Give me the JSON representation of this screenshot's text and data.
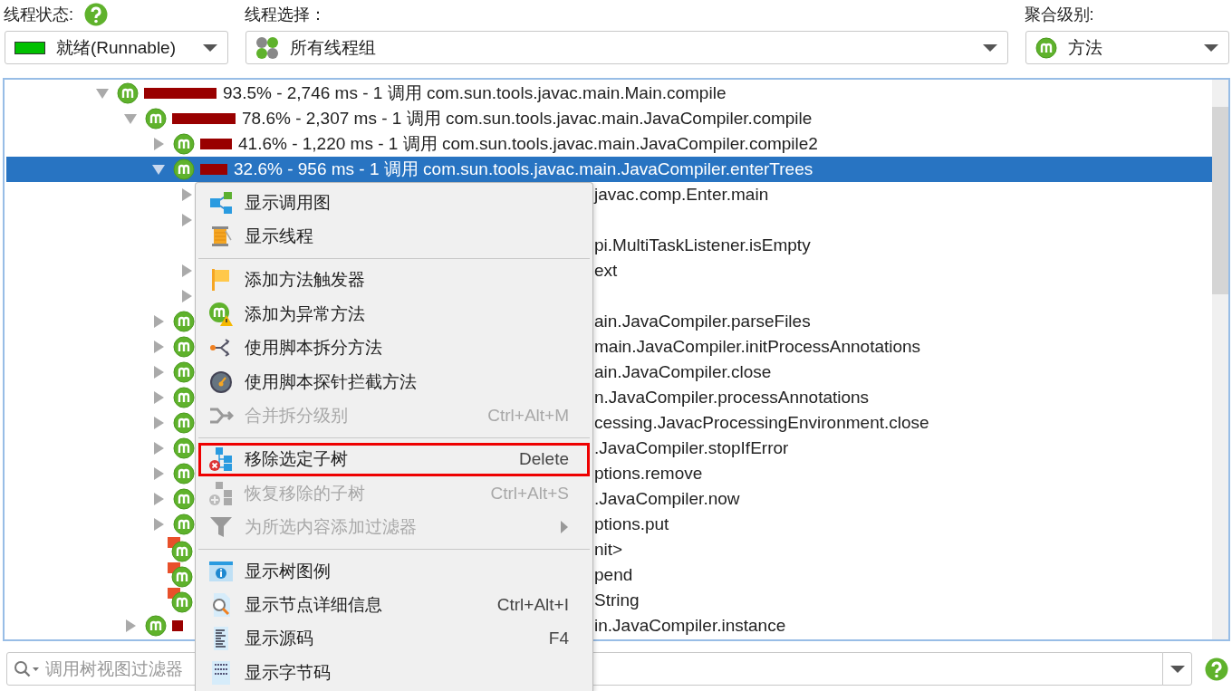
{
  "toolbar": {
    "thread_state": {
      "label": "线程状态:",
      "value": "就绪(Runnable)",
      "color": "#00c000"
    },
    "thread_selection": {
      "label": "线程选择：",
      "value": "所有线程组"
    },
    "aggregation": {
      "label": "聚合级别:",
      "value": "方法"
    }
  },
  "call_tree": {
    "rows": [
      {
        "kind": "method",
        "expanded": true,
        "selected": false,
        "text": "93.5% - 2,746 ms - 1 调用 com.sun.tools.javac.main.Main.compile",
        "children": [
          {
            "kind": "method",
            "expanded": true,
            "selected": false,
            "text": "78.6% - 2,307 ms - 1 调用 com.sun.tools.javac.main.JavaCompiler.compile",
            "children": [
              {
                "kind": "method",
                "expanded": false,
                "selected": false,
                "text": "41.6% - 1,220 ms - 1 调用 com.sun.tools.javac.main.JavaCompiler.compile2"
              },
              {
                "kind": "method",
                "expanded": true,
                "selected": true,
                "text": "32.6% - 956 ms - 1 调用 com.sun.tools.javac.main.JavaCompiler.enterTrees",
                "children": [
                  {
                    "expanded": false,
                    "selected": false,
                    "tail": "javac.comp.Enter.main"
                  },
                  {
                    "expanded": false,
                    "selected": false
                  },
                  {
                    "selected": false,
                    "tail": "pi.MultiTaskListener.isEmpty"
                  },
                  {
                    "expanded": false,
                    "selected": false,
                    "tail": "ext"
                  },
                  {
                    "expanded": false,
                    "selected": false
                  }
                ]
              },
              {
                "kind": "method",
                "expanded": false,
                "selected": false,
                "tail": "ain.JavaCompiler.parseFiles"
              },
              {
                "kind": "method",
                "expanded": false,
                "selected": false,
                "tail": "main.JavaCompiler.initProcessAnnotations"
              },
              {
                "kind": "method",
                "expanded": false,
                "selected": false,
                "tail": "ain.JavaCompiler.close"
              },
              {
                "kind": "method",
                "expanded": false,
                "selected": false,
                "tail": "n.JavaCompiler.processAnnotations"
              },
              {
                "kind": "method",
                "expanded": false,
                "selected": false,
                "tail": "cessing.JavacProcessingEnvironment.close"
              },
              {
                "kind": "method",
                "expanded": false,
                "selected": false,
                "tail": ".JavaCompiler.stopIfError"
              },
              {
                "kind": "method",
                "expanded": false,
                "selected": false,
                "tail": "ptions.remove"
              },
              {
                "kind": "method",
                "expanded": false,
                "selected": false,
                "tail": ".JavaCompiler.now"
              },
              {
                "kind": "method",
                "expanded": false,
                "selected": false,
                "tail": "ptions.put"
              },
              {
                "kind": "flagged-method",
                "selected": false,
                "tail": "nit>"
              },
              {
                "kind": "flagged-method",
                "selected": false,
                "tail": "pend"
              },
              {
                "kind": "flagged-method",
                "selected": false,
                "tail": "String"
              }
            ]
          },
          {
            "kind": "method",
            "expanded": false,
            "selected": false,
            "tail": "in.JavaCompiler.instance"
          }
        ]
      }
    ]
  },
  "context_menu": {
    "groups": [
      [
        {
          "label": "显示调用图",
          "disabled": false,
          "outlined": false,
          "submenu": false
        },
        {
          "label": "显示线程",
          "disabled": false,
          "outlined": false,
          "submenu": false
        }
      ],
      [
        {
          "label": "添加方法触发器",
          "disabled": false,
          "outlined": false,
          "submenu": false
        },
        {
          "label": "添加为异常方法",
          "disabled": false,
          "outlined": false,
          "submenu": false
        },
        {
          "label": "使用脚本拆分方法",
          "disabled": false,
          "outlined": false,
          "submenu": false
        },
        {
          "label": "使用脚本探针拦截方法",
          "disabled": false,
          "outlined": false,
          "submenu": false
        },
        {
          "label": "合并拆分级别",
          "shortcut": "Ctrl+Alt+M",
          "disabled": true,
          "outlined": false,
          "submenu": false
        }
      ],
      [
        {
          "label": "移除选定子树",
          "shortcut": "Delete",
          "disabled": false,
          "outlined": true,
          "submenu": false
        },
        {
          "label": "恢复移除的子树",
          "shortcut": "Ctrl+Alt+S",
          "disabled": true,
          "outlined": false,
          "submenu": false
        },
        {
          "label": "为所选内容添加过滤器",
          "disabled": true,
          "outlined": false,
          "submenu": true
        }
      ],
      [
        {
          "label": "显示树图例",
          "disabled": false,
          "outlined": false,
          "submenu": false
        },
        {
          "label": "显示节点详细信息",
          "shortcut": "Ctrl+Alt+I",
          "disabled": false,
          "outlined": false,
          "submenu": false
        },
        {
          "label": "显示源码",
          "shortcut": "F4",
          "disabled": false,
          "outlined": false,
          "submenu": false
        },
        {
          "label": "显示字节码",
          "disabled": false,
          "outlined": false,
          "submenu": false
        }
      ]
    ]
  },
  "filter": {
    "placeholder": "调用树视图过滤器"
  }
}
